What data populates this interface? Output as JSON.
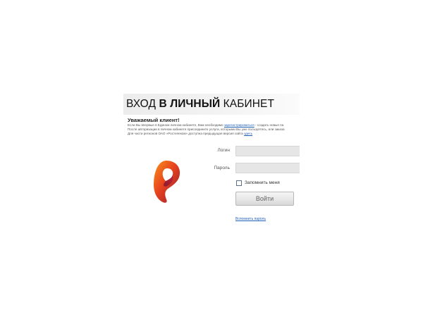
{
  "header": {
    "title_prefix": "ВХОД ",
    "title_bold": "В ЛИЧНЫЙ",
    "title_suffix": " КАБИНЕТ"
  },
  "intro": {
    "greeting": "Уважаемый клиент!",
    "line1_text": "Если Вы впервые в Едином личном кабинете, Вам необходимо ",
    "line1_link": "зарегистрироваться",
    "line1_after": " - создать новые па",
    "line2_text": "После авторизации в личном кабинете присоедините услуги, которыми Вы уже пользуетесь, или заказа",
    "line3_text": "Для части регионов ОАО «Ростелеком» доступна предыдущая версия сайта ",
    "line3_link": "здесь"
  },
  "form": {
    "login_label": "Логин",
    "login_value": "",
    "password_label": "Пароль",
    "password_value": "",
    "remember_label": "Запомнить меня",
    "remember_checked": false,
    "submit_label": "Войти",
    "forgot_label": "Вспомнить пароль"
  },
  "logo": {
    "icon": "rostelecom-logo-icon",
    "color_light": "#f7941d",
    "color_mid": "#e8431e",
    "color_dark": "#8e1b33"
  }
}
